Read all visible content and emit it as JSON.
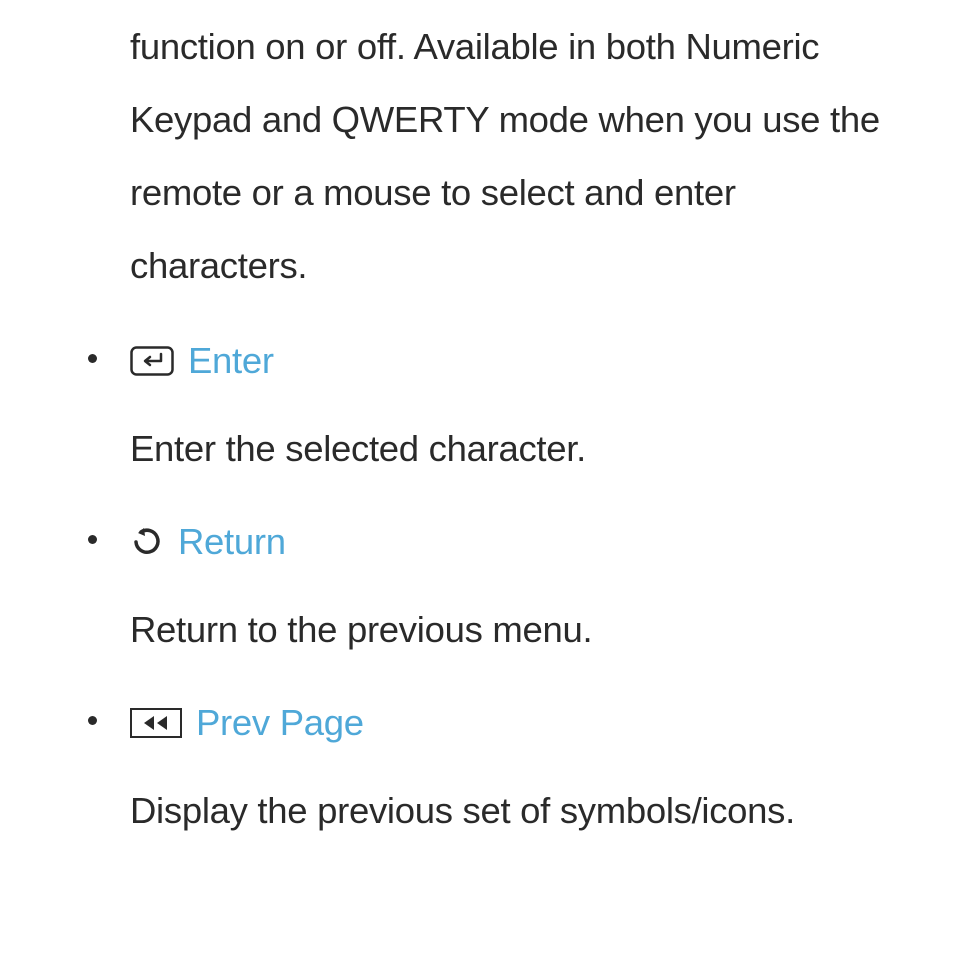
{
  "intro": "function on or off. Available in both Numeric Keypad and QWERTY mode when you use the remote or a mouse to select and enter characters.",
  "items": [
    {
      "icon": "enter-icon",
      "label": "Enter",
      "description": "Enter the selected character."
    },
    {
      "icon": "return-icon",
      "label": "Return",
      "description": "Return to the previous menu."
    },
    {
      "icon": "prev-page-icon",
      "label": "Prev Page",
      "description": "Display the previous set of symbols/icons."
    }
  ]
}
